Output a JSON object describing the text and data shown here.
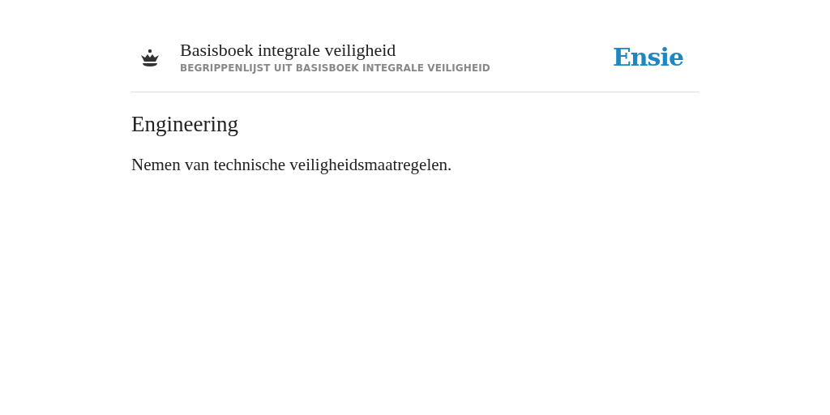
{
  "header": {
    "title": "Basisboek integrale veiligheid",
    "subtitle": "BEGRIPPENLIJST UIT BASISBOEK INTEGRALE VEILIGHEID",
    "brand": "Ensie"
  },
  "entry": {
    "term": "Engineering",
    "definition": "Nemen van technische veiligheidsmaatregelen."
  }
}
